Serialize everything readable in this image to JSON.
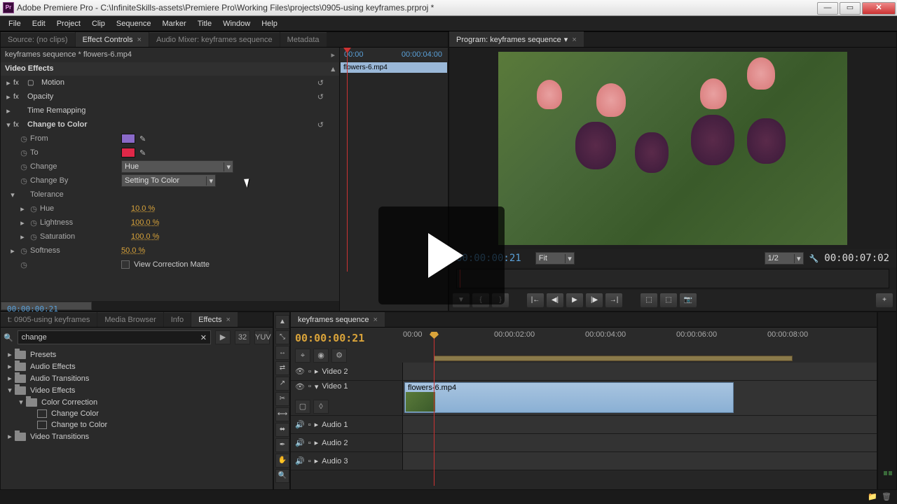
{
  "title": "Adobe Premiere Pro - C:\\InfiniteSkills-assets\\Premiere Pro\\Working Files\\projects\\0905-using keyframes.prproj *",
  "menu": [
    "File",
    "Edit",
    "Project",
    "Clip",
    "Sequence",
    "Marker",
    "Title",
    "Window",
    "Help"
  ],
  "topTabs": {
    "source": "Source: (no clips)",
    "ec": "Effect Controls",
    "amix": "Audio Mixer: keyframes sequence",
    "meta": "Metadata"
  },
  "ec": {
    "path": "keyframes sequence * flowers-6.mp4",
    "section": "Video Effects",
    "motion": "Motion",
    "opacity": "Opacity",
    "timeremap": "Time Remapping",
    "ctc": "Change to Color",
    "from": "From",
    "to": "To",
    "change": "Change",
    "changeVal": "Hue",
    "changeBy": "Change By",
    "changeByVal": "Setting To Color",
    "tolerance": "Tolerance",
    "hue": "Hue",
    "hueVal": "10.0 %",
    "lightness": "Lightness",
    "lightnessVal": "100.0 %",
    "saturation": "Saturation",
    "saturationVal": "100.0 %",
    "softness": "Softness",
    "softnessVal": "50.0 %",
    "viewMatte": "View Correction Matte",
    "timeStart": "00:00",
    "timeEnd": "00:00:04:00",
    "clipName": "flowers-6.mp4",
    "fromColor": "#8a6ac8",
    "toColor": "#e02848"
  },
  "footerTc": "00:00:00:21",
  "program": {
    "tab": "Program: keyframes sequence",
    "tc": "00:00:00:21",
    "fit": "Fit",
    "zoom": "1/2",
    "dur": "00:00:07:02"
  },
  "browser": {
    "tabs": [
      "t: 0905-using keyframes",
      "Media Browser",
      "Info",
      "Effects"
    ],
    "search": "change",
    "presets": "Presets",
    "audioFx": "Audio Effects",
    "audioTr": "Audio Transitions",
    "videoFx": "Video Effects",
    "colorCorr": "Color Correction",
    "changeColor": "Change Color",
    "changeToColor": "Change to Color",
    "videoTr": "Video Transitions"
  },
  "timeline": {
    "tab": "keyframes sequence",
    "tc": "00:00:00:21",
    "marks": [
      "00:00",
      "00:00:02:00",
      "00:00:04:00",
      "00:00:06:00",
      "00:00:08:00"
    ],
    "v2": "Video 2",
    "v1": "Video 1",
    "a1": "Audio 1",
    "a2": "Audio 2",
    "a3": "Audio 3",
    "clip": "flowers-6.mp4"
  }
}
